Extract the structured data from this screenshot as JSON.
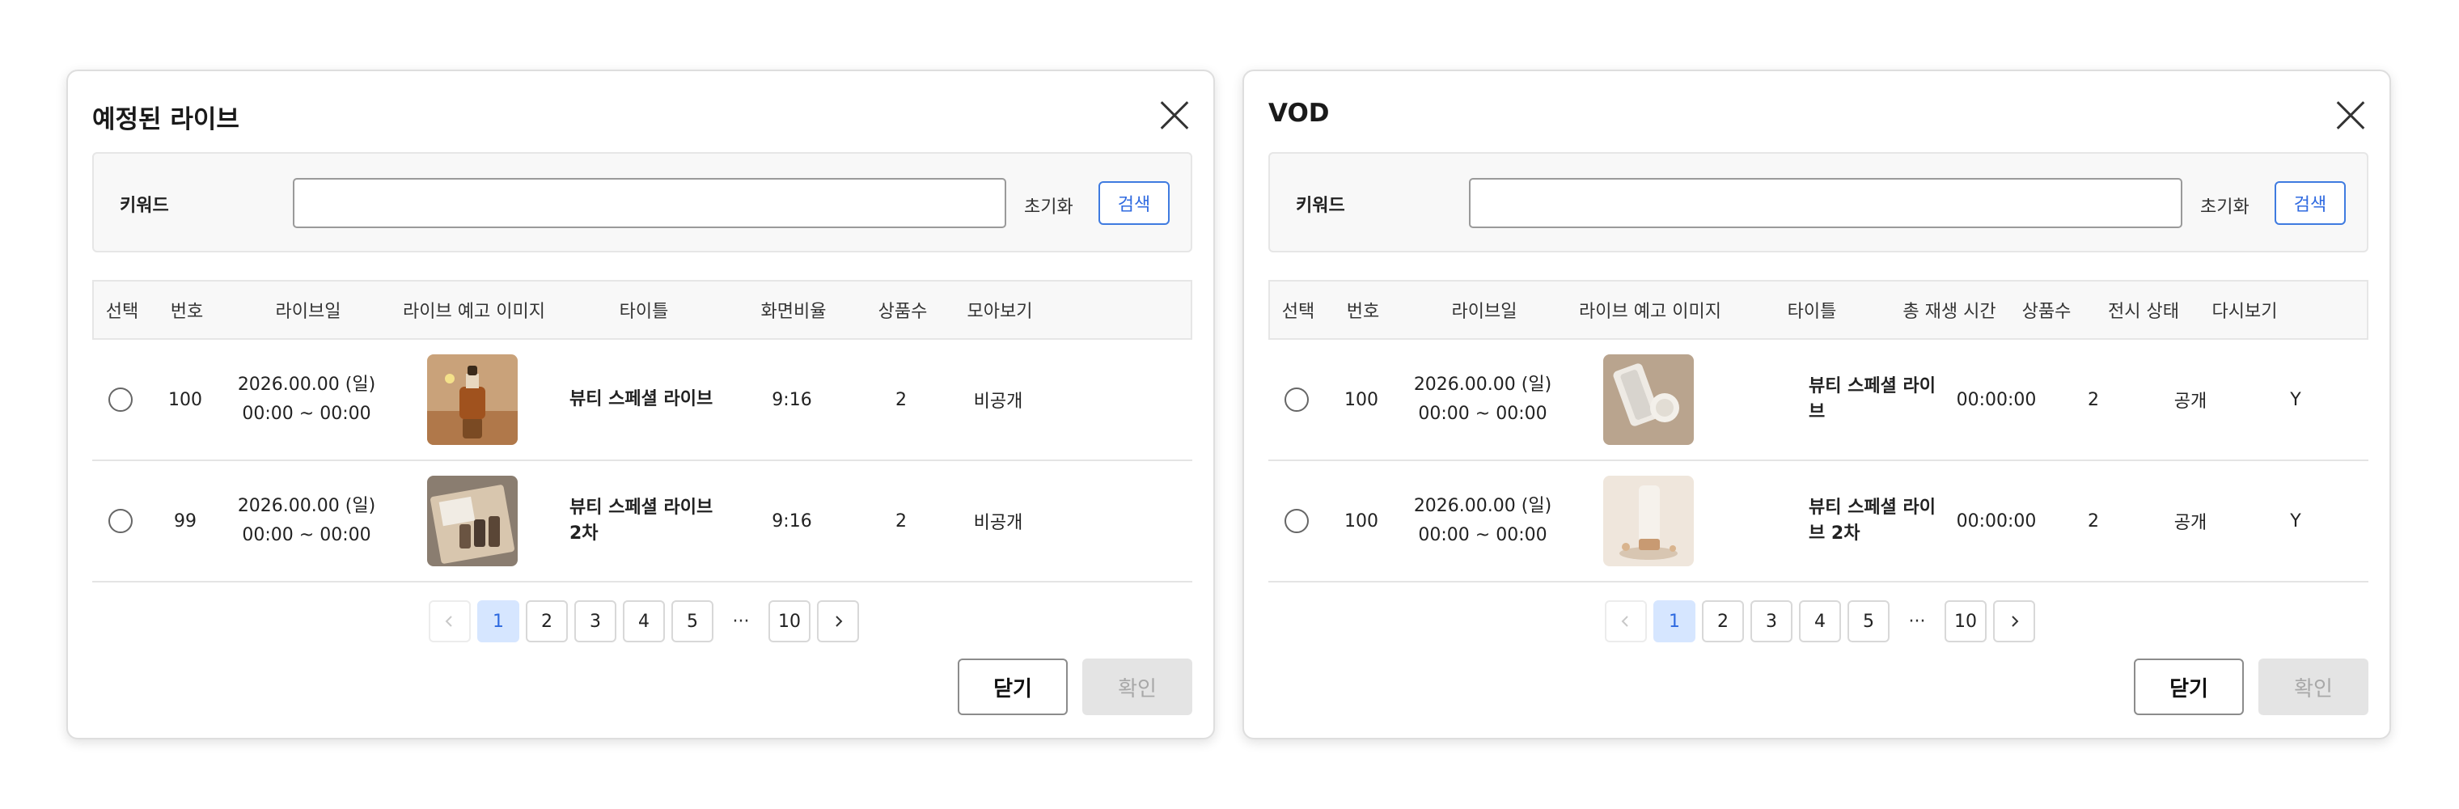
{
  "modals": [
    {
      "title": "예정된 라이브",
      "search": {
        "keyword_label": "키워드",
        "keyword_value": "",
        "reset_label": "초기화",
        "search_label": "검색"
      },
      "columns": [
        "선택",
        "번호",
        "라이브일",
        "라이브 예고 이미지",
        "타이틀",
        "화면비율",
        "상품수",
        "모아보기"
      ],
      "rows": [
        {
          "number": "100",
          "date_line1": "2026.00.00 (일)",
          "date_line2": "00:00 ~ 00:00",
          "thumb_icon": "serum-bottle-photo",
          "title": "뷰티 스페셜 라이브",
          "ratio": "9:16",
          "products": "2",
          "visibility": "비공개"
        },
        {
          "number": "99",
          "date_line1": "2026.00.00 (일)",
          "date_line2": "00:00 ~ 00:00",
          "thumb_icon": "cosmetic-box-photo",
          "title": "뷰티 스페셜 라이브 2차",
          "ratio": "9:16",
          "products": "2",
          "visibility": "비공개"
        }
      ],
      "pagination": {
        "prev_icon": "chevron-left-icon",
        "pages": [
          "1",
          "2",
          "3",
          "4",
          "5"
        ],
        "ellipsis": "···",
        "last": "10",
        "next_icon": "chevron-right-icon",
        "current": "1"
      },
      "footer": {
        "close_label": "닫기",
        "confirm_label": "확인"
      }
    },
    {
      "title": "VOD",
      "search": {
        "keyword_label": "키워드",
        "keyword_value": "",
        "reset_label": "초기화",
        "search_label": "검색"
      },
      "columns": [
        "선택",
        "번호",
        "라이브일",
        "라이브 예고 이미지",
        "타이틀",
        "총 재생 시간",
        "상품수",
        "전시 상태",
        "다시보기"
      ],
      "rows": [
        {
          "number": "100",
          "date_line1": "2026.00.00 (일)",
          "date_line2": "00:00 ~ 00:00",
          "thumb_icon": "cream-product-photo",
          "title": "뷰티 스페셜 라이브",
          "duration": "00:00:00",
          "products": "2",
          "status": "공개",
          "replay": "Y"
        },
        {
          "number": "100",
          "date_line1": "2026.00.00 (일)",
          "date_line2": "00:00 ~ 00:00",
          "thumb_icon": "tube-product-photo",
          "title": "뷰티 스페셜 라이브 2차",
          "duration": "00:00:00",
          "products": "2",
          "status": "공개",
          "replay": "Y"
        }
      ],
      "pagination": {
        "prev_icon": "chevron-left-icon",
        "pages": [
          "1",
          "2",
          "3",
          "4",
          "5"
        ],
        "ellipsis": "···",
        "last": "10",
        "next_icon": "chevron-right-icon",
        "current": "1"
      },
      "footer": {
        "close_label": "닫기",
        "confirm_label": "확인"
      }
    }
  ],
  "colors": {
    "accent": "#2f6ae0",
    "active_page_bg": "#d6e6ff",
    "disabled_button_bg": "#e4e4e4"
  }
}
